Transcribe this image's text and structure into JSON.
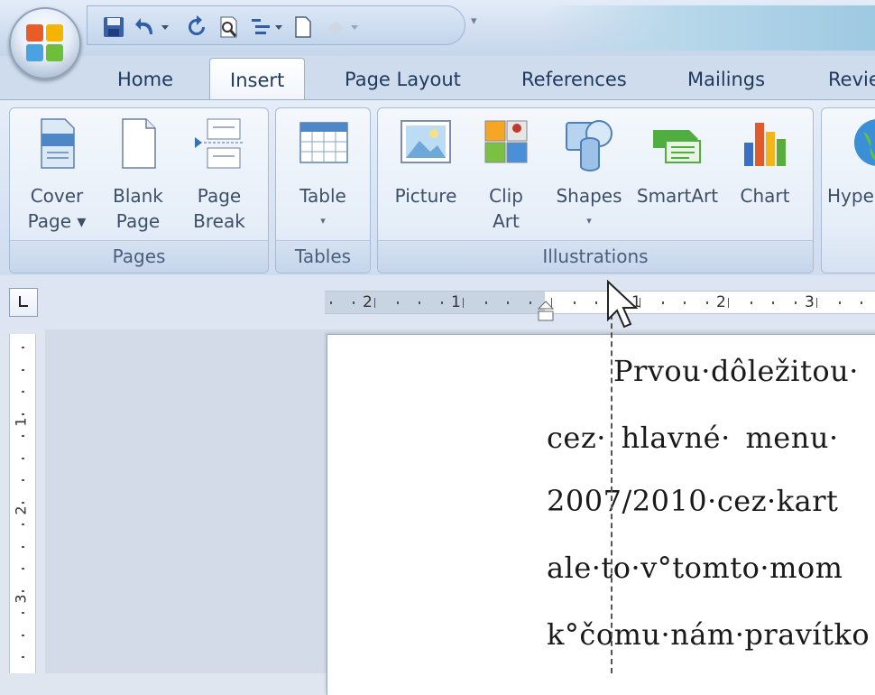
{
  "quick_access": {
    "icons": [
      "office-button-icon",
      "save-icon",
      "undo-icon",
      "undo-dropdown-icon",
      "redo-icon",
      "print-preview-icon",
      "outline-icon",
      "new-document-icon",
      "paint-icon",
      "customize-dropdown-icon"
    ]
  },
  "tabs": [
    {
      "label": "Home",
      "active": false
    },
    {
      "label": "Insert",
      "active": true
    },
    {
      "label": "Page Layout",
      "active": false
    },
    {
      "label": "References",
      "active": false
    },
    {
      "label": "Mailings",
      "active": false
    },
    {
      "label": "Revie",
      "active": false
    }
  ],
  "ribbon": {
    "groups": {
      "pages": {
        "label": "Pages",
        "buttons": [
          {
            "line1": "Cover",
            "line2": "Page ▾",
            "icon": "cover-page-icon"
          },
          {
            "line1": "Blank",
            "line2": "Page",
            "icon": "blank-page-icon"
          },
          {
            "line1": "Page",
            "line2": "Break",
            "icon": "page-break-icon"
          }
        ]
      },
      "tables": {
        "label": "Tables",
        "buttons": [
          {
            "line1": "Table",
            "line2": "▾",
            "icon": "table-icon"
          }
        ]
      },
      "illustrations": {
        "label": "Illustrations",
        "buttons": [
          {
            "line1": "Picture",
            "line2": "",
            "icon": "picture-icon"
          },
          {
            "line1": "Clip",
            "line2": "Art",
            "icon": "clip-art-icon"
          },
          {
            "line1": "Shapes",
            "line2": "▾",
            "icon": "shapes-icon"
          },
          {
            "line1": "SmartArt",
            "line2": "",
            "icon": "smartart-icon"
          },
          {
            "line1": "Chart",
            "line2": "",
            "icon": "chart-icon"
          }
        ]
      },
      "links": {
        "buttons": [
          {
            "line1": "Hype",
            "icon": "hyperlink-icon"
          }
        ]
      }
    }
  },
  "ruler": {
    "labels": [
      "2",
      "1",
      "1",
      "2",
      "3"
    ],
    "vertical_labels": [
      "1",
      "2",
      "3"
    ]
  },
  "document": {
    "lines": [
      "Prvou·dôležitou·",
      "cez·  hlavné·  menu·",
      "2007/2010·cez·kart",
      "ale·to·v°tomto·mom",
      "k°čomu·nám·pravítko"
    ]
  },
  "colors": {
    "ribbon_text": "#3d4f68",
    "tab_text": "#1e395b",
    "group_label": "#4a5f7c",
    "doc_text": "#1a1a1a"
  }
}
